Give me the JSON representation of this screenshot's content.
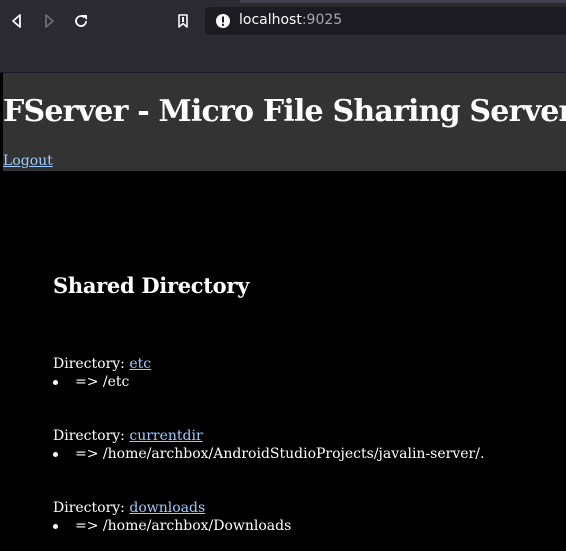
{
  "browser": {
    "url_host": "localhost",
    "url_port": ":9025",
    "icons": {
      "back": "back-arrow-icon",
      "forward": "forward-arrow-icon",
      "reload": "reload-icon",
      "bookmark": "bookmark-icon",
      "site_info": "info-icon"
    }
  },
  "header": {
    "title": "FServer - Micro File Sharing Server",
    "logout_label": "Logout"
  },
  "main": {
    "section_title": "Shared Directory",
    "directory_prefix": "Directory:",
    "entries": [
      {
        "name": "etc",
        "path": "=> /etc"
      },
      {
        "name": "currentdir",
        "path": "=> /home/archbox/AndroidStudioProjects/javalin-server/."
      },
      {
        "name": "downloads",
        "path": "=> /home/archbox/Downloads"
      }
    ]
  },
  "colors": {
    "chrome_bg": "#2b2a33",
    "header_bg": "#333333",
    "page_bg": "#000000",
    "link": "#9ecbff",
    "text": "#ffffff"
  }
}
